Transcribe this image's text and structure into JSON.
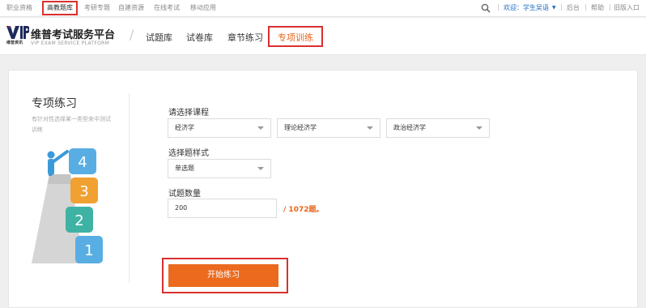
{
  "topbar": {
    "links": [
      "职业资格",
      "高教题库",
      "考研专题",
      "自建资源",
      "在线考试",
      "移动应用"
    ],
    "welcome": "欢迎：学生吴语",
    "right_links": [
      "后台",
      "帮助",
      "旧版入口"
    ]
  },
  "header": {
    "brand": "维普考试服务平台",
    "brand_sub": "维普资讯",
    "brand_en": "VIP EXAM SERVICE PLATFORM",
    "nav": [
      "试题库",
      "试卷库",
      "章节练习",
      "专项训练"
    ]
  },
  "sidebar": {
    "title": "专项练习",
    "desc": "有针对性选择某一类型来中测试训练",
    "steps": [
      "4",
      "3",
      "2",
      "1"
    ]
  },
  "form": {
    "course_label": "请选择课程",
    "course_1": "经济学",
    "course_2": "理论经济学",
    "course_3": "政治经济学",
    "type_label": "选择题样式",
    "type_value": "单选题",
    "count_label": "试题数量",
    "count_value": "200",
    "count_total": "/ 1072题。",
    "start_label": "开始练习"
  },
  "colors": {
    "accent": "#ec6a1d",
    "highlight": "#d9302f",
    "link": "#1f6fbf"
  }
}
